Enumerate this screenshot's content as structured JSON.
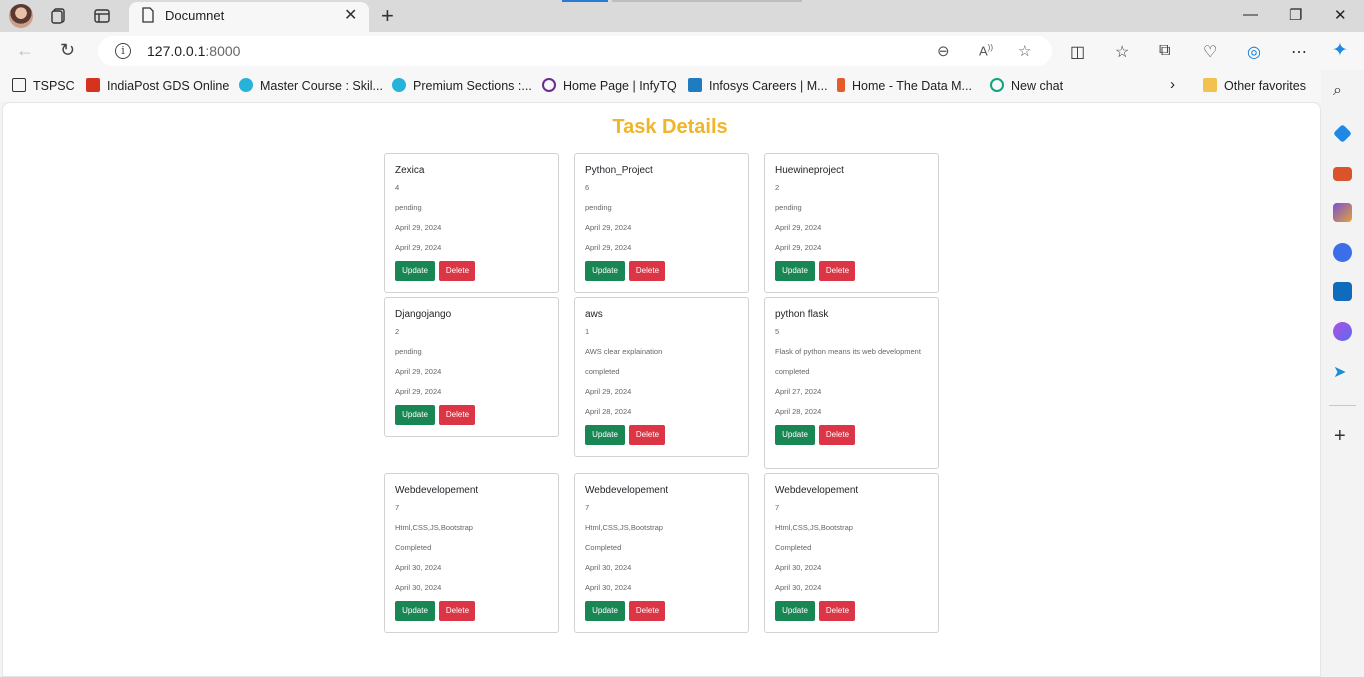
{
  "browser": {
    "tab_title": "Documnet",
    "url_host": "127.0.0.1",
    "url_port": ":8000",
    "bookmarks": [
      {
        "label": "TSPSC",
        "color": "#ffffff"
      },
      {
        "label": "IndiaPost GDS Online",
        "color": "#d6331f"
      },
      {
        "label": "Master Course : Skil...",
        "color": "#27b3d9"
      },
      {
        "label": "Premium Sections :...",
        "color": "#27b3d9"
      },
      {
        "label": "Home Page | InfyTQ",
        "color": "#6a2c91"
      },
      {
        "label": "Infosys Careers | M...",
        "color": "#1f7cc1"
      },
      {
        "label": "Home - The Data M...",
        "color": "#e35d2a"
      },
      {
        "label": "New chat",
        "color": "#10a37f"
      }
    ],
    "other_favorites": "Other favorites"
  },
  "page": {
    "title": "Task Details",
    "update_label": "Update",
    "delete_label": "Delete"
  },
  "tasks": [
    {
      "name": "Zexica",
      "priority": "4",
      "description": "",
      "status": "pending",
      "date1": "April 29, 2024",
      "date2": "April 29, 2024"
    },
    {
      "name": "Python_Project",
      "priority": "6",
      "description": "",
      "status": "pending",
      "date1": "April 29, 2024",
      "date2": "April 29, 2024"
    },
    {
      "name": "Huewineproject",
      "priority": "2",
      "description": "",
      "status": "pending",
      "date1": "April 29, 2024",
      "date2": "April 29, 2024"
    },
    {
      "name": "Djangojango",
      "priority": "2",
      "description": "",
      "status": "pending",
      "date1": "April 29, 2024",
      "date2": "April 29, 2024"
    },
    {
      "name": "aws",
      "priority": "1",
      "description": "AWS clear explaination",
      "status": "completed",
      "date1": "April 29, 2024",
      "date2": "April 28, 2024"
    },
    {
      "name": "python flask",
      "priority": "5",
      "description": "Flask of python means its web development",
      "status": "completed",
      "date1": "April 27, 2024",
      "date2": "April 28, 2024"
    },
    {
      "name": "Webdevelopement",
      "priority": "7",
      "description": "Html,CSS,JS,Bootstrap",
      "status": "Completed",
      "date1": "April 30, 2024",
      "date2": "April 30, 2024"
    },
    {
      "name": "Webdevelopement",
      "priority": "7",
      "description": "Html,CSS,JS,Bootstrap",
      "status": "Completed",
      "date1": "April 30, 2024",
      "date2": "April 30, 2024"
    },
    {
      "name": "Webdevelopement",
      "priority": "7",
      "description": "Html,CSS,JS,Bootstrap",
      "status": "Completed",
      "date1": "April 30, 2024",
      "date2": "April 30, 2024"
    }
  ]
}
